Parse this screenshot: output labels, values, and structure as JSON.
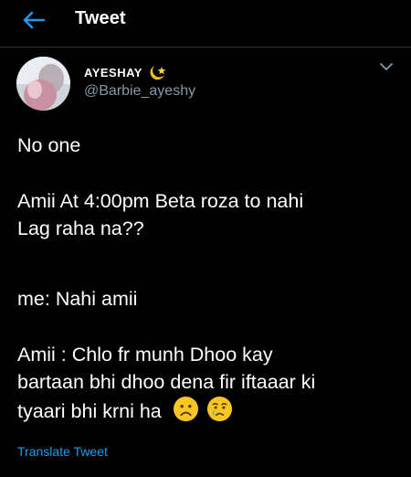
{
  "header": {
    "title": "Tweet",
    "back_icon": "arrow-left-icon"
  },
  "tweet": {
    "author_name": "AYESHAY",
    "author_handle": "@Barbie_ayeshy",
    "name_badge_icon": "moon-star-emoji-icon",
    "menu_icon": "chevron-down-icon",
    "lines": {
      "l1": "No one",
      "l2": "Amii At 4:00pm Beta roza to nahi",
      "l3": "Lag raha na??",
      "l4": "me: Nahi amii",
      "l5": "Amii : Chlo fr munh Dhoo kay",
      "l6": "bartaan bhi dhoo dena fir iftaaar ki",
      "l7": "tyaari bhi krni ha"
    },
    "emojis": [
      "frowning-face-emoji",
      "crying-face-emoji"
    ],
    "translate_label": "Translate Tweet"
  },
  "colors": {
    "background": "#000000",
    "text": "#ffffff",
    "secondary_text": "#8899a6",
    "accent": "#1d9bf0",
    "divider": "#2f3336"
  }
}
